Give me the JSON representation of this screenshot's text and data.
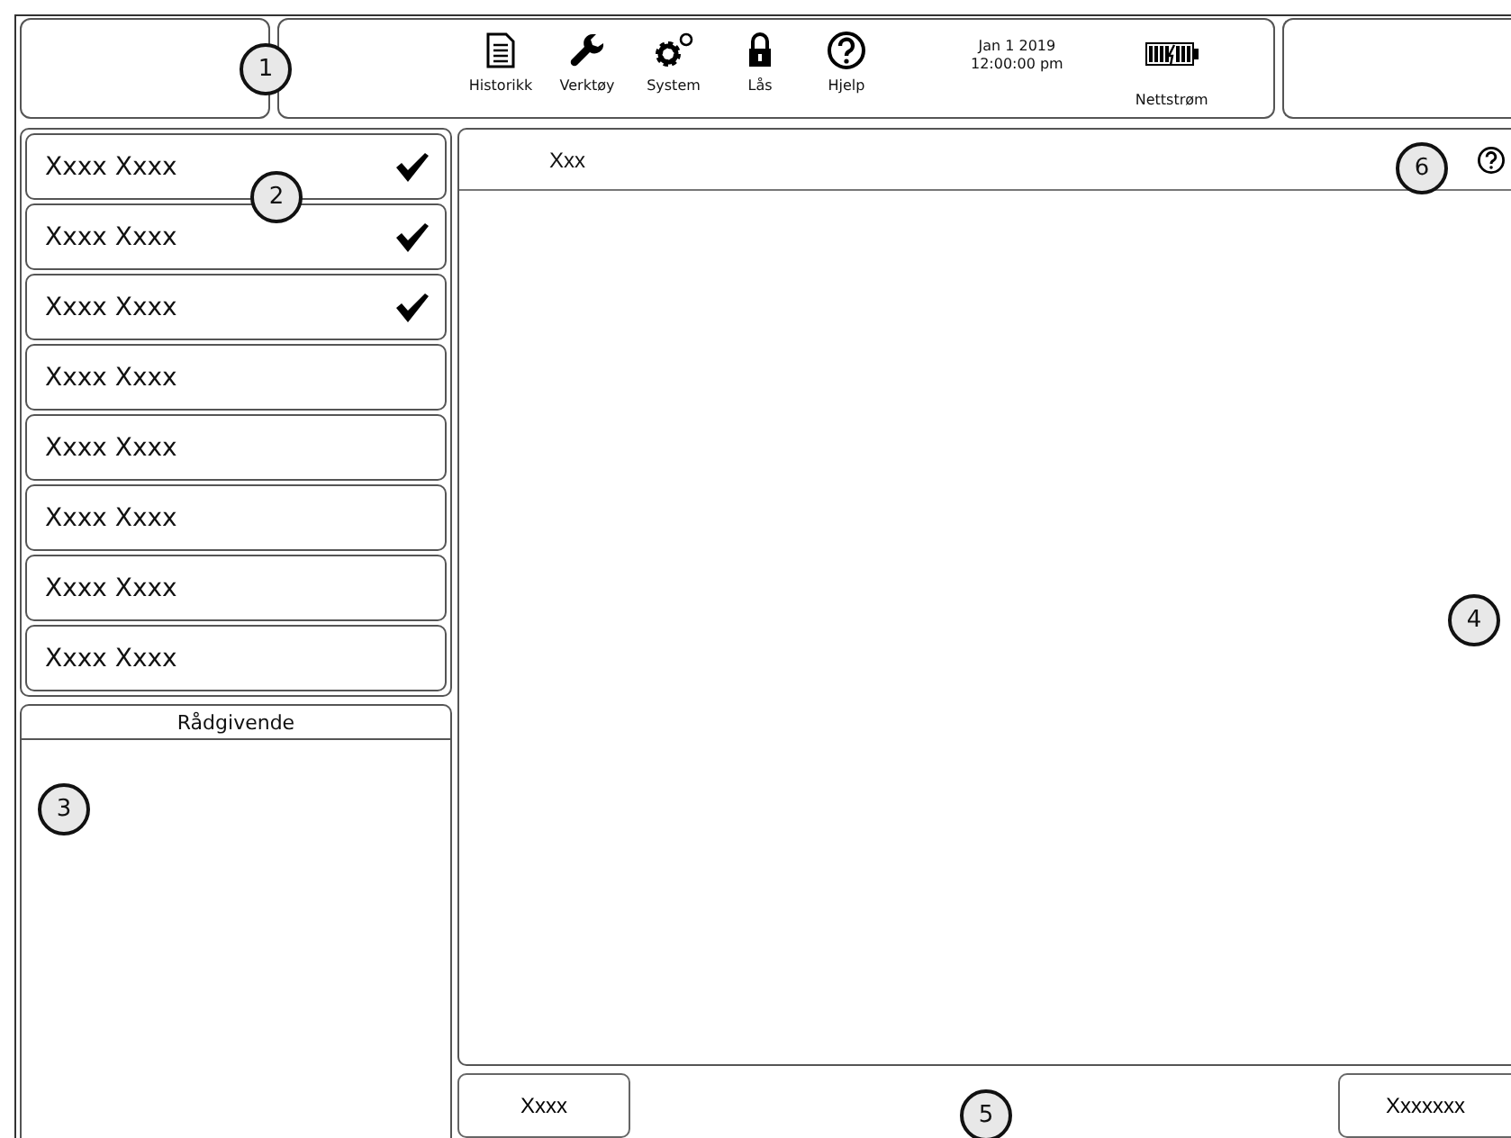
{
  "toolbar": [
    {
      "kind": "document",
      "label": "Historikk"
    },
    {
      "kind": "wrench",
      "label": "Verktøy"
    },
    {
      "kind": "gears",
      "label": "System"
    },
    {
      "kind": "lock",
      "label": "Lås"
    },
    {
      "kind": "help",
      "label": "Hjelp"
    }
  ],
  "clock": {
    "date": "Jan 1 2019",
    "time": "12:00:00 pm"
  },
  "power": {
    "label": "Nettstrøm"
  },
  "list_items": [
    {
      "label": "Xxxx Xxxx",
      "checked": true
    },
    {
      "label": "Xxxx Xxxx",
      "checked": true
    },
    {
      "label": "Xxxx Xxxx",
      "checked": true
    },
    {
      "label": "Xxxx Xxxx",
      "checked": false
    },
    {
      "label": "Xxxx Xxxx",
      "checked": false
    },
    {
      "label": "Xxxx Xxxx",
      "checked": false
    },
    {
      "label": "Xxxx Xxxx",
      "checked": false
    },
    {
      "label": "Xxxx Xxxx",
      "checked": false
    }
  ],
  "advisory": {
    "title": "Rådgivende"
  },
  "main": {
    "title": "Xxx"
  },
  "buttons": [
    "Xxxx",
    "Xxxxxxx"
  ],
  "callouts": [
    "1",
    "2",
    "3",
    "4",
    "5",
    "6"
  ]
}
